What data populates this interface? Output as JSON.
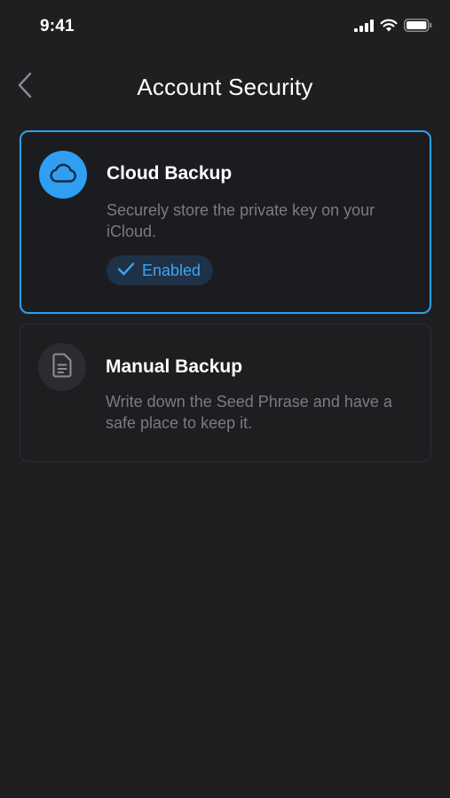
{
  "status_bar": {
    "time": "9:41"
  },
  "header": {
    "title": "Account Security"
  },
  "options": [
    {
      "title": "Cloud Backup",
      "description": "Securely store the private key on your iCloud.",
      "status": "Enabled",
      "icon": "cloud-icon",
      "selected": true
    },
    {
      "title": "Manual Backup",
      "description": "Write down the Seed Phrase and have a safe place to keep it.",
      "icon": "document-icon",
      "selected": false
    }
  ],
  "colors": {
    "background": "#1f1f22",
    "accent": "#2f9ef3",
    "muted_text": "#7b7b80"
  }
}
